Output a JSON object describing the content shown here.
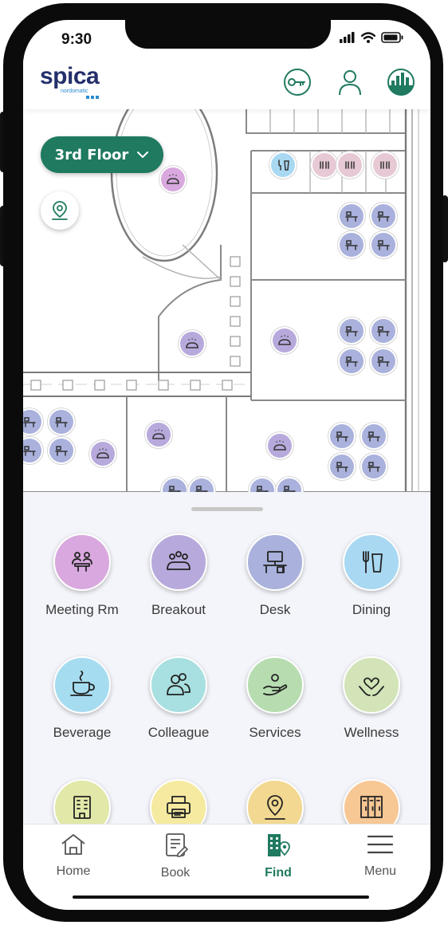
{
  "status_bar": {
    "time": "9:30"
  },
  "header": {
    "logo_text": "spica",
    "logo_subtext": "nordomatic",
    "icons": [
      "key-icon",
      "profile-icon",
      "building-avatar-icon"
    ]
  },
  "map": {
    "floor_selector": "3rd Floor",
    "location_button_icon": "location-pin-icon",
    "pin_counts": {
      "desk": 26,
      "breakout": 6,
      "meeting": 1,
      "wc": 3,
      "dining": 1
    }
  },
  "categories": [
    {
      "label": "Meeting Rm",
      "icon": "meeting-room-icon",
      "color": "#d8a8de"
    },
    {
      "label": "Breakout",
      "icon": "breakout-icon",
      "color": "#b8a9dc"
    },
    {
      "label": "Desk",
      "icon": "desk-icon",
      "color": "#a9b1dc"
    },
    {
      "label": "Dining",
      "icon": "dining-icon",
      "color": "#a9d8f2"
    },
    {
      "label": "Beverage",
      "icon": "beverage-icon",
      "color": "#a6dcf0"
    },
    {
      "label": "Colleague",
      "icon": "colleague-icon",
      "color": "#a8dfe0"
    },
    {
      "label": "Services",
      "icon": "services-icon",
      "color": "#b6dcb0"
    },
    {
      "label": "Wellness",
      "icon": "wellness-icon",
      "color": "#d2e4b8"
    },
    {
      "label": "",
      "icon": "building-icon",
      "color": "#e2e8a8"
    },
    {
      "label": "",
      "icon": "printer-icon",
      "color": "#f5eaa0"
    },
    {
      "label": "",
      "icon": "location-pin-icon",
      "color": "#f2d890"
    },
    {
      "label": "",
      "icon": "locker-icon",
      "color": "#f7c794"
    }
  ],
  "tabbar": {
    "tabs": [
      {
        "label": "Home",
        "icon": "home-icon",
        "active": false
      },
      {
        "label": "Book",
        "icon": "book-icon",
        "active": false
      },
      {
        "label": "Find",
        "icon": "find-icon",
        "active": true
      },
      {
        "label": "Menu",
        "icon": "menu-icon",
        "active": false
      }
    ],
    "accent_color": "#1f7a60"
  }
}
